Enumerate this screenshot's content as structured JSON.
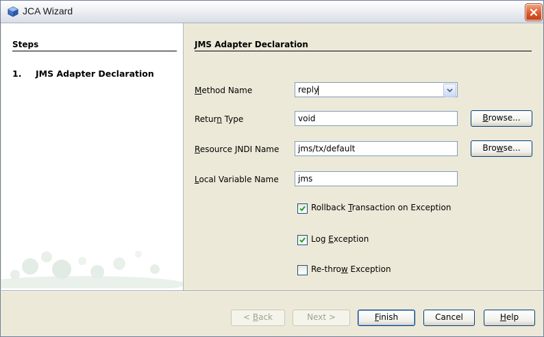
{
  "window": {
    "title": "JCA Wizard"
  },
  "steps": {
    "heading": "Steps",
    "items": [
      {
        "number": "1.",
        "label": "JMS Adapter Declaration"
      }
    ]
  },
  "panel": {
    "heading": "JMS Adapter Declaration",
    "method_name": {
      "label_mnemonic": "M",
      "label_rest": "ethod Name",
      "value": "reply"
    },
    "return_type": {
      "label_pre": "Retur",
      "label_mnemonic": "n",
      "label_post": " Type",
      "value": "void"
    },
    "resource_jndi": {
      "label_mnemonic": "R",
      "label_rest": "esource JNDI Name",
      "value": "jms/tx/default"
    },
    "local_variable": {
      "label_mnemonic": "L",
      "label_rest": "ocal Variable Name",
      "value": "jms"
    },
    "browse_return": {
      "mnemonic": "B",
      "rest": "rowse..."
    },
    "browse_resource": {
      "pre": "Bro",
      "mnemonic": "w",
      "post": "se..."
    },
    "options": [
      {
        "pre": "Rollback ",
        "mnemonic": "T",
        "post": "ransaction on Exception",
        "checked": true
      },
      {
        "pre": "Log ",
        "mnemonic": "E",
        "post": "xception",
        "checked": true
      },
      {
        "pre": "Re-thro",
        "mnemonic": "w",
        "post": " Exception",
        "checked": false
      }
    ]
  },
  "footer": {
    "back": {
      "pre": "< ",
      "mnemonic": "B",
      "post": "ack"
    },
    "next": "Next >",
    "finish": {
      "mnemonic": "F",
      "post": "inish"
    },
    "cancel": "Cancel",
    "help": {
      "mnemonic": "H",
      "post": "elp"
    }
  },
  "colors": {
    "window_border": "#6b7f9c",
    "dialog_bg": "#ece9d8",
    "close_red": "#d8572a",
    "check_green": "#21a121"
  }
}
